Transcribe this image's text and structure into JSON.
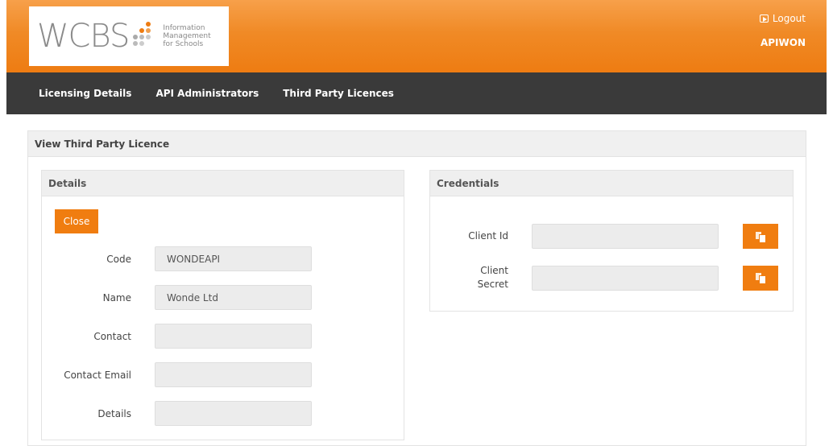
{
  "header": {
    "logo_text": "WCBS",
    "logo_tagline": [
      "Information",
      "Management",
      "for Schools"
    ],
    "logout_label": "Logout",
    "username": "APIWON"
  },
  "nav": {
    "items": [
      {
        "label": "Licensing Details"
      },
      {
        "label": "API Administrators"
      },
      {
        "label": "Third Party Licences"
      }
    ]
  },
  "page": {
    "title": "View Third Party Licence"
  },
  "details": {
    "heading": "Details",
    "close_label": "Close",
    "fields": [
      {
        "label": "Code",
        "value": ""
      },
      {
        "label": "Name",
        "value": ""
      },
      {
        "label": "Contact",
        "value": ""
      },
      {
        "label": "Contact Email",
        "value": ""
      },
      {
        "label": "Details",
        "value": ""
      }
    ],
    "values": {
      "code": "WONDEAPI",
      "name": "Wonde Ltd",
      "contact": "",
      "contact_email": "",
      "details": ""
    }
  },
  "credentials": {
    "heading": "Credentials",
    "client_id_label": "Client Id",
    "client_secret_label": [
      "Client",
      "Secret"
    ],
    "client_id_value": "",
    "client_secret_value": ""
  },
  "colors": {
    "brand_orange": "#f07d10",
    "nav_dark": "#3a3a3a",
    "panel_header": "#f0f0f0"
  },
  "icons": {
    "logout": "logout-icon",
    "copy": "copy-icon"
  }
}
